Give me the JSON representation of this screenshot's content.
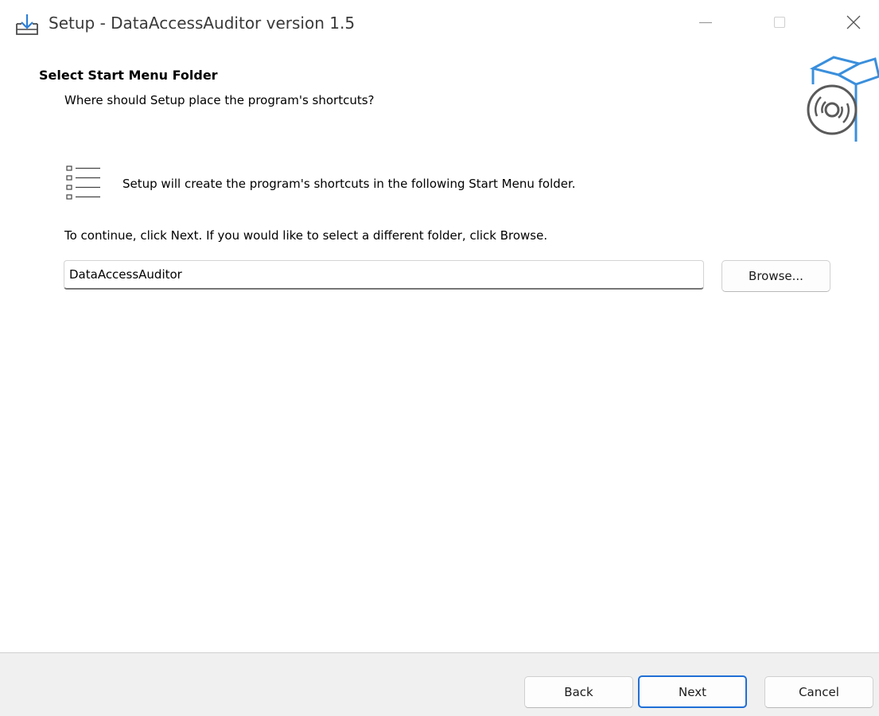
{
  "window": {
    "title": "Setup - DataAccessAuditor version 1.5"
  },
  "window_controls": {
    "minimize_icon": "minimize-icon",
    "maximize_icon": "maximize-icon",
    "close_icon": "close-icon"
  },
  "header": {
    "title": "Select Start Menu Folder",
    "subtitle": "Where should Setup place the program's shortcuts?",
    "image_icon": "installer-box-disc-icon"
  },
  "body": {
    "info_icon": "shortcut-list-icon",
    "info_text": "Setup will create the program's shortcuts in the following Start Menu folder.",
    "instruction_text": "To continue, click Next. If you would like to select a different folder, click Browse.",
    "folder_input_value": "DataAccessAuditor",
    "browse_label": "Browse..."
  },
  "footer": {
    "back_label": "Back",
    "next_label": "Next",
    "cancel_label": "Cancel"
  },
  "colors": {
    "accent": "#1f6fd6",
    "footer_background": "#f0f0f0",
    "icon_blue": "#3a8fdc"
  }
}
